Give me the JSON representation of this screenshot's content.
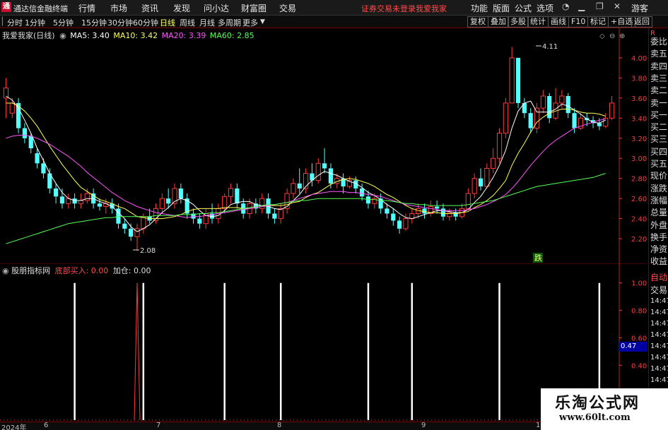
{
  "app": {
    "logo_glyph": "通",
    "title": "通达信金融终端",
    "menus": [
      "行情",
      "市场",
      "资讯",
      "发现",
      "问小达",
      "财富圈",
      "交易"
    ],
    "warning": "证券交易未登录",
    "user_link": "我爱我家",
    "right_menus": [
      "功能",
      "版面",
      "公式",
      "选项"
    ],
    "guest": "游客"
  },
  "toolbar": {
    "periods": [
      "分时",
      "1分钟",
      "5分钟",
      "15分钟",
      "30分钟",
      "60分钟",
      "日线",
      "周线",
      "月线",
      "多周期",
      "更多"
    ],
    "active": "日线",
    "right_buttons": [
      "复权",
      "叠加",
      "多股",
      "统计",
      "画线",
      "F10",
      "标记",
      "+自选",
      "返回"
    ]
  },
  "main_legend": {
    "title": "我爱我家(日线)",
    "ma5": "MA5: 3.40",
    "ma10": "MA10: 3.42",
    "ma20": "MA20: 3.39",
    "ma60": "MA60: 2.85"
  },
  "indicator_legend": {
    "title": "股朋指标网",
    "bottom_buy": "底部买入: 0.00",
    "add_pos": "加仓: 0.00"
  },
  "annotations": {
    "high": "4.11",
    "low": "2.08",
    "drop_tag": "跌"
  },
  "right_panel": {
    "labels": [
      "委比",
      "卖五",
      "卖四",
      "卖三",
      "卖二",
      "卖一",
      "买一",
      "买二",
      "买三",
      "买四",
      "买五",
      "现价",
      "涨跌",
      "涨幅",
      "总量",
      "外盘",
      "换手",
      "净资",
      "收益"
    ],
    "auto_label": "自动",
    "trade_label": "交易",
    "times": [
      "14:47",
      "14:47",
      "14:47",
      "14:47",
      "14:47",
      "14:47",
      "14:47",
      "14:47",
      "14:47",
      "14:47"
    ]
  },
  "indicator_value_box": "0.47",
  "dates": {
    "year": "2024年",
    "months": [
      "6",
      "7",
      "8",
      "9",
      "10"
    ]
  },
  "watermark": {
    "line1": "乐淘公式网",
    "line2": "www.60lt.com"
  },
  "colors": {
    "up": "#ff3a3a",
    "down": "#54ffff",
    "ma5": "#ffffff",
    "ma10": "#ffff55",
    "ma20": "#ff55ff",
    "ma60": "#55ff55",
    "axis": "#ff3a3a"
  },
  "chart_data": [
    {
      "type": "candlestick",
      "title": "我爱我家(日线)",
      "y_ticks": [
        4.0,
        3.8,
        3.6,
        3.4,
        3.2,
        3.0,
        2.8,
        2.6,
        2.4,
        2.2
      ],
      "ylim": [
        2.06,
        4.14
      ],
      "x_labels": [
        "2024年",
        "6",
        "7",
        "8",
        "9",
        "10"
      ],
      "candles": [
        [
          3.6,
          3.7,
          3.8,
          3.4
        ],
        [
          3.45,
          3.55,
          3.6,
          3.4
        ],
        [
          3.55,
          3.3,
          3.6,
          3.25
        ],
        [
          3.3,
          3.2,
          3.35,
          3.15
        ],
        [
          3.22,
          3.1,
          3.25,
          3.05
        ],
        [
          3.05,
          2.95,
          3.1,
          2.9
        ],
        [
          2.95,
          2.85,
          3.0,
          2.8
        ],
        [
          2.85,
          2.7,
          2.9,
          2.65
        ],
        [
          2.7,
          2.62,
          2.75,
          2.55
        ],
        [
          2.62,
          2.55,
          2.7,
          2.5
        ],
        [
          2.55,
          2.6,
          2.65,
          2.5
        ],
        [
          2.6,
          2.55,
          2.65,
          2.5
        ],
        [
          2.55,
          2.58,
          2.65,
          2.5
        ],
        [
          2.58,
          2.65,
          2.7,
          2.55
        ],
        [
          2.65,
          2.55,
          2.7,
          2.5
        ],
        [
          2.55,
          2.52,
          2.6,
          2.48
        ],
        [
          2.52,
          2.55,
          2.6,
          2.45
        ],
        [
          2.55,
          2.5,
          2.6,
          2.45
        ],
        [
          2.5,
          2.35,
          2.55,
          2.3
        ],
        [
          2.35,
          2.3,
          2.4,
          2.25
        ],
        [
          2.3,
          2.22,
          2.35,
          2.18
        ],
        [
          2.22,
          2.3,
          2.35,
          2.08
        ],
        [
          2.3,
          2.42,
          2.45,
          2.25
        ],
        [
          2.42,
          2.38,
          2.5,
          2.35
        ],
        [
          2.38,
          2.5,
          2.55,
          2.35
        ],
        [
          2.5,
          2.6,
          2.65,
          2.45
        ],
        [
          2.6,
          2.55,
          2.7,
          2.5
        ],
        [
          2.55,
          2.7,
          2.75,
          2.5
        ],
        [
          2.7,
          2.6,
          2.75,
          2.55
        ],
        [
          2.6,
          2.45,
          2.65,
          2.4
        ],
        [
          2.45,
          2.4,
          2.5,
          2.35
        ],
        [
          2.4,
          2.35,
          2.45,
          2.3
        ],
        [
          2.35,
          2.45,
          2.5,
          2.3
        ],
        [
          2.45,
          2.4,
          2.55,
          2.35
        ],
        [
          2.4,
          2.5,
          2.55,
          2.35
        ],
        [
          2.5,
          2.62,
          2.65,
          2.45
        ],
        [
          2.62,
          2.7,
          2.75,
          2.55
        ],
        [
          2.7,
          2.55,
          2.75,
          2.5
        ],
        [
          2.55,
          2.45,
          2.6,
          2.4
        ],
        [
          2.45,
          2.55,
          2.6,
          2.4
        ],
        [
          2.55,
          2.5,
          2.6,
          2.45
        ],
        [
          2.5,
          2.6,
          2.65,
          2.45
        ],
        [
          2.6,
          2.45,
          2.65,
          2.4
        ],
        [
          2.45,
          2.4,
          2.5,
          2.35
        ],
        [
          2.4,
          2.5,
          2.55,
          2.35
        ],
        [
          2.5,
          2.65,
          2.7,
          2.45
        ],
        [
          2.65,
          2.75,
          2.8,
          2.6
        ],
        [
          2.75,
          2.7,
          2.9,
          2.65
        ],
        [
          2.7,
          2.85,
          2.9,
          2.65
        ],
        [
          2.85,
          2.78,
          2.95,
          2.72
        ],
        [
          2.78,
          2.95,
          3.0,
          2.75
        ],
        [
          2.95,
          2.9,
          3.1,
          2.85
        ],
        [
          2.9,
          2.75,
          2.95,
          2.7
        ],
        [
          2.75,
          2.8,
          2.85,
          2.7
        ],
        [
          2.8,
          2.72,
          2.85,
          2.65
        ],
        [
          2.72,
          2.78,
          2.82,
          2.7
        ],
        [
          2.78,
          2.7,
          2.82,
          2.65
        ],
        [
          2.7,
          2.62,
          2.75,
          2.58
        ],
        [
          2.62,
          2.55,
          2.68,
          2.5
        ],
        [
          2.55,
          2.6,
          2.65,
          2.5
        ],
        [
          2.6,
          2.5,
          2.65,
          2.45
        ],
        [
          2.5,
          2.45,
          2.55,
          2.4
        ],
        [
          2.45,
          2.38,
          2.5,
          2.33
        ],
        [
          2.38,
          2.3,
          2.42,
          2.25
        ],
        [
          2.3,
          2.4,
          2.45,
          2.28
        ],
        [
          2.4,
          2.45,
          2.5,
          2.35
        ],
        [
          2.45,
          2.5,
          2.55,
          2.4
        ],
        [
          2.5,
          2.45,
          2.55,
          2.4
        ],
        [
          2.45,
          2.52,
          2.58,
          2.42
        ],
        [
          2.52,
          2.5,
          2.58,
          2.45
        ],
        [
          2.5,
          2.42,
          2.55,
          2.38
        ],
        [
          2.42,
          2.46,
          2.5,
          2.38
        ],
        [
          2.46,
          2.42,
          2.5,
          2.38
        ],
        [
          2.42,
          2.5,
          2.55,
          2.4
        ],
        [
          2.5,
          2.65,
          2.7,
          2.48
        ],
        [
          2.65,
          2.8,
          2.85,
          2.6
        ],
        [
          2.8,
          2.72,
          2.9,
          2.68
        ],
        [
          2.72,
          2.9,
          2.95,
          2.7
        ],
        [
          2.9,
          3.0,
          3.1,
          2.85
        ],
        [
          3.0,
          3.25,
          3.3,
          2.95
        ],
        [
          3.25,
          3.55,
          3.6,
          3.2
        ],
        [
          3.55,
          4.0,
          4.11,
          3.55
        ],
        [
          4.0,
          3.55,
          4.0,
          3.5
        ],
        [
          3.55,
          3.45,
          3.6,
          3.4
        ],
        [
          3.45,
          3.3,
          3.5,
          3.25
        ],
        [
          3.3,
          3.5,
          3.55,
          3.25
        ],
        [
          3.5,
          3.62,
          3.68,
          3.45
        ],
        [
          3.62,
          3.4,
          3.65,
          3.35
        ],
        [
          3.4,
          3.55,
          3.7,
          3.38
        ],
        [
          3.55,
          3.62,
          3.68,
          3.5
        ],
        [
          3.62,
          3.45,
          3.65,
          3.4
        ],
        [
          3.45,
          3.3,
          3.5,
          3.25
        ],
        [
          3.3,
          3.4,
          3.45,
          3.28
        ],
        [
          3.4,
          3.38,
          3.45,
          3.32
        ],
        [
          3.38,
          3.35,
          3.42,
          3.3
        ],
        [
          3.35,
          3.32,
          3.4,
          3.28
        ],
        [
          3.32,
          3.4,
          3.45,
          3.3
        ],
        [
          3.4,
          3.55,
          3.62,
          3.38
        ]
      ],
      "series": [
        {
          "name": "MA5",
          "values": [
            3.62,
            3.58,
            3.5,
            3.38,
            3.25,
            3.1,
            2.98,
            2.85,
            2.75,
            2.66,
            2.6,
            2.58,
            2.58,
            2.6,
            2.6,
            2.57,
            2.55,
            2.52,
            2.46,
            2.4,
            2.32,
            2.27,
            2.3,
            2.34,
            2.4,
            2.46,
            2.51,
            2.57,
            2.6,
            2.58,
            2.54,
            2.48,
            2.43,
            2.42,
            2.43,
            2.48,
            2.54,
            2.56,
            2.57,
            2.57,
            2.54,
            2.53,
            2.52,
            2.5,
            2.49,
            2.52,
            2.58,
            2.64,
            2.72,
            2.78,
            2.83,
            2.87,
            2.85,
            2.83,
            2.8,
            2.77,
            2.75,
            2.71,
            2.66,
            2.63,
            2.59,
            2.54,
            2.5,
            2.45,
            2.41,
            2.4,
            2.42,
            2.44,
            2.46,
            2.48,
            2.48,
            2.47,
            2.46,
            2.46,
            2.49,
            2.56,
            2.62,
            2.71,
            2.81,
            2.93,
            3.08,
            3.3,
            3.47,
            3.55,
            3.57,
            3.46,
            3.46,
            3.46,
            3.49,
            3.54,
            3.52,
            3.48,
            3.44,
            3.39,
            3.36,
            3.35,
            3.38
          ]
        },
        {
          "name": "MA10",
          "values": [
            3.55,
            3.55,
            3.52,
            3.47,
            3.4,
            3.32,
            3.22,
            3.12,
            3.03,
            2.94,
            2.86,
            2.78,
            2.71,
            2.67,
            2.63,
            2.59,
            2.57,
            2.55,
            2.52,
            2.5,
            2.46,
            2.42,
            2.41,
            2.4,
            2.4,
            2.4,
            2.41,
            2.42,
            2.44,
            2.47,
            2.49,
            2.5,
            2.5,
            2.5,
            2.5,
            2.51,
            2.51,
            2.51,
            2.5,
            2.5,
            2.51,
            2.52,
            2.53,
            2.53,
            2.53,
            2.54,
            2.56,
            2.57,
            2.61,
            2.64,
            2.66,
            2.7,
            2.74,
            2.77,
            2.79,
            2.8,
            2.79,
            2.77,
            2.75,
            2.72,
            2.68,
            2.64,
            2.61,
            2.57,
            2.53,
            2.5,
            2.48,
            2.47,
            2.46,
            2.46,
            2.45,
            2.45,
            2.45,
            2.46,
            2.47,
            2.51,
            2.54,
            2.58,
            2.63,
            2.7,
            2.78,
            2.93,
            3.05,
            3.15,
            3.26,
            3.36,
            3.41,
            3.45,
            3.47,
            3.49,
            3.49,
            3.48,
            3.46,
            3.45,
            3.45,
            3.44,
            3.42
          ]
        },
        {
          "name": "MA20",
          "values": [
            3.2,
            3.22,
            3.23,
            3.23,
            3.22,
            3.2,
            3.17,
            3.14,
            3.1,
            3.06,
            3.02,
            2.97,
            2.92,
            2.86,
            2.81,
            2.76,
            2.71,
            2.66,
            2.62,
            2.58,
            2.55,
            2.52,
            2.5,
            2.48,
            2.46,
            2.45,
            2.44,
            2.43,
            2.42,
            2.41,
            2.42,
            2.42,
            2.43,
            2.44,
            2.45,
            2.46,
            2.47,
            2.48,
            2.49,
            2.5,
            2.51,
            2.52,
            2.53,
            2.54,
            2.55,
            2.56,
            2.58,
            2.6,
            2.62,
            2.64,
            2.65,
            2.66,
            2.67,
            2.67,
            2.67,
            2.66,
            2.66,
            2.65,
            2.64,
            2.63,
            2.62,
            2.6,
            2.58,
            2.56,
            2.54,
            2.53,
            2.52,
            2.51,
            2.5,
            2.49,
            2.48,
            2.48,
            2.48,
            2.48,
            2.49,
            2.5,
            2.52,
            2.54,
            2.57,
            2.6,
            2.64,
            2.7,
            2.77,
            2.85,
            2.93,
            3.0,
            3.07,
            3.13,
            3.18,
            3.22,
            3.26,
            3.3,
            3.32,
            3.34,
            3.36,
            3.38,
            3.39
          ]
        },
        {
          "name": "MA60",
          "values": [
            2.15,
            2.17,
            2.19,
            2.21,
            2.23,
            2.25,
            2.27,
            2.29,
            2.31,
            2.33,
            2.35,
            2.36,
            2.37,
            2.38,
            2.39,
            2.4,
            2.41,
            2.41,
            2.42,
            2.42,
            2.42,
            2.42,
            2.42,
            2.42,
            2.43,
            2.43,
            2.43,
            2.43,
            2.44,
            2.44,
            2.44,
            2.45,
            2.45,
            2.46,
            2.46,
            2.47,
            2.48,
            2.49,
            2.5,
            2.51,
            2.52,
            2.53,
            2.54,
            2.54,
            2.55,
            2.56,
            2.57,
            2.58,
            2.58,
            2.59,
            2.6,
            2.6,
            2.6,
            2.6,
            2.6,
            2.6,
            2.6,
            2.6,
            2.59,
            2.59,
            2.58,
            2.58,
            2.57,
            2.56,
            2.55,
            2.55,
            2.54,
            2.54,
            2.53,
            2.53,
            2.53,
            2.53,
            2.53,
            2.53,
            2.54,
            2.55,
            2.56,
            2.57,
            2.58,
            2.6,
            2.62,
            2.64,
            2.66,
            2.68,
            2.7,
            2.72,
            2.73,
            2.74,
            2.75,
            2.76,
            2.77,
            2.78,
            2.79,
            2.8,
            2.81,
            2.83,
            2.85
          ]
        }
      ]
    },
    {
      "type": "bar",
      "title": "股朋指标网",
      "y_ticks": [
        1.0,
        0.8,
        0.6,
        0.4,
        0.2
      ],
      "ylim": [
        0,
        1.05
      ],
      "series": [
        {
          "name": "底部买入",
          "signal_indices": [
            11,
            22,
            35,
            44,
            58,
            65,
            79,
            95
          ],
          "value": 1.0
        },
        {
          "name": "加仓",
          "spike_index": 21,
          "value": 1.0
        }
      ]
    }
  ]
}
